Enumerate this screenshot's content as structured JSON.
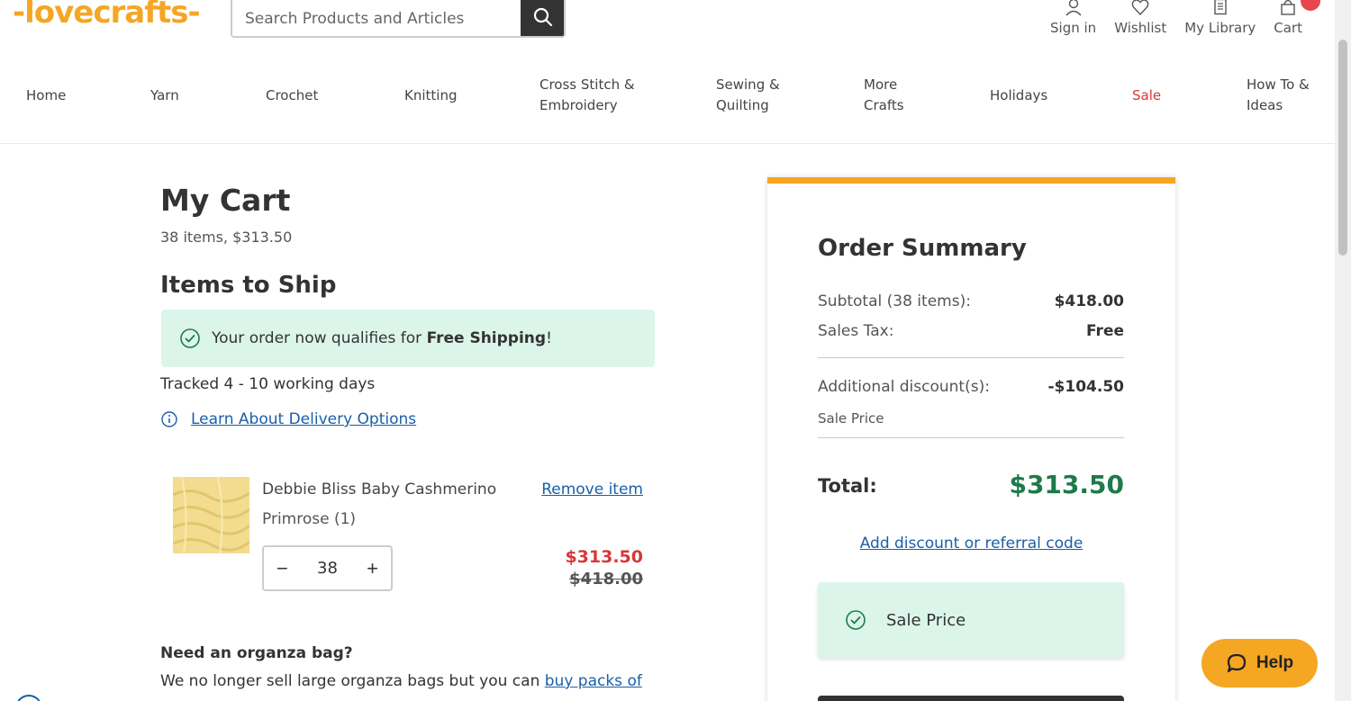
{
  "brand": {
    "logo_text": "-lovecrafts-",
    "accent": "#f5a623"
  },
  "search": {
    "placeholder": "Search Products and Articles",
    "icon": "search-icon"
  },
  "util_nav": {
    "sign_in": "Sign in",
    "wishlist": "Wishlist",
    "library": "My Library",
    "cart": "Cart"
  },
  "main_nav": {
    "home": "Home",
    "yarn": "Yarn",
    "crochet": "Crochet",
    "knitting": "Knitting",
    "cross_stitch_1": "Cross Stitch &",
    "cross_stitch_2": "Embroidery",
    "sewing_1": "Sewing &",
    "sewing_2": "Quilting",
    "more_1": "More",
    "more_2": "Crafts",
    "holidays": "Holidays",
    "sale": "Sale",
    "howto_1": "How To &",
    "howto_2": "Ideas"
  },
  "cart": {
    "title": "My Cart",
    "meta": "38 items, $313.50",
    "section_title": "Items to Ship",
    "shipping_prefix": "Your order now qualifies for ",
    "shipping_bold": "Free Shipping",
    "shipping_suffix": "!",
    "tracked": "Tracked 4 - 10 working days",
    "delivery_link": "Learn About Delivery Options",
    "item": {
      "name": "Debbie Bliss Baby Cashmerino",
      "variant": "Primrose (1)",
      "remove": "Remove item",
      "minus": "−",
      "quantity": "38",
      "plus": "+",
      "sale_price": "$313.50",
      "original_price": "$418.00"
    },
    "organza_title": "Need an organza bag?",
    "organza_text": "We no longer sell large organza bags but you can ",
    "organza_link": "buy packs of"
  },
  "summary": {
    "title": "Order Summary",
    "subtotal_label": "Subtotal (38 items):",
    "subtotal_value": "$418.00",
    "tax_label": "Sales Tax:",
    "tax_value": "Free",
    "discount_label": "Additional discount(s):",
    "discount_value": "-$104.50",
    "discount_note": "Sale Price",
    "total_label": "Total:",
    "total_value": "$313.50",
    "discount_link": "Add discount or referral code",
    "sale_card_label": "Sale Price"
  },
  "help": {
    "label": "Help"
  },
  "colors": {
    "sale_red": "#d63838",
    "total_green": "#1f7a4a",
    "banner_mint": "#dcf5ea",
    "link_blue": "#1a5fa8"
  }
}
